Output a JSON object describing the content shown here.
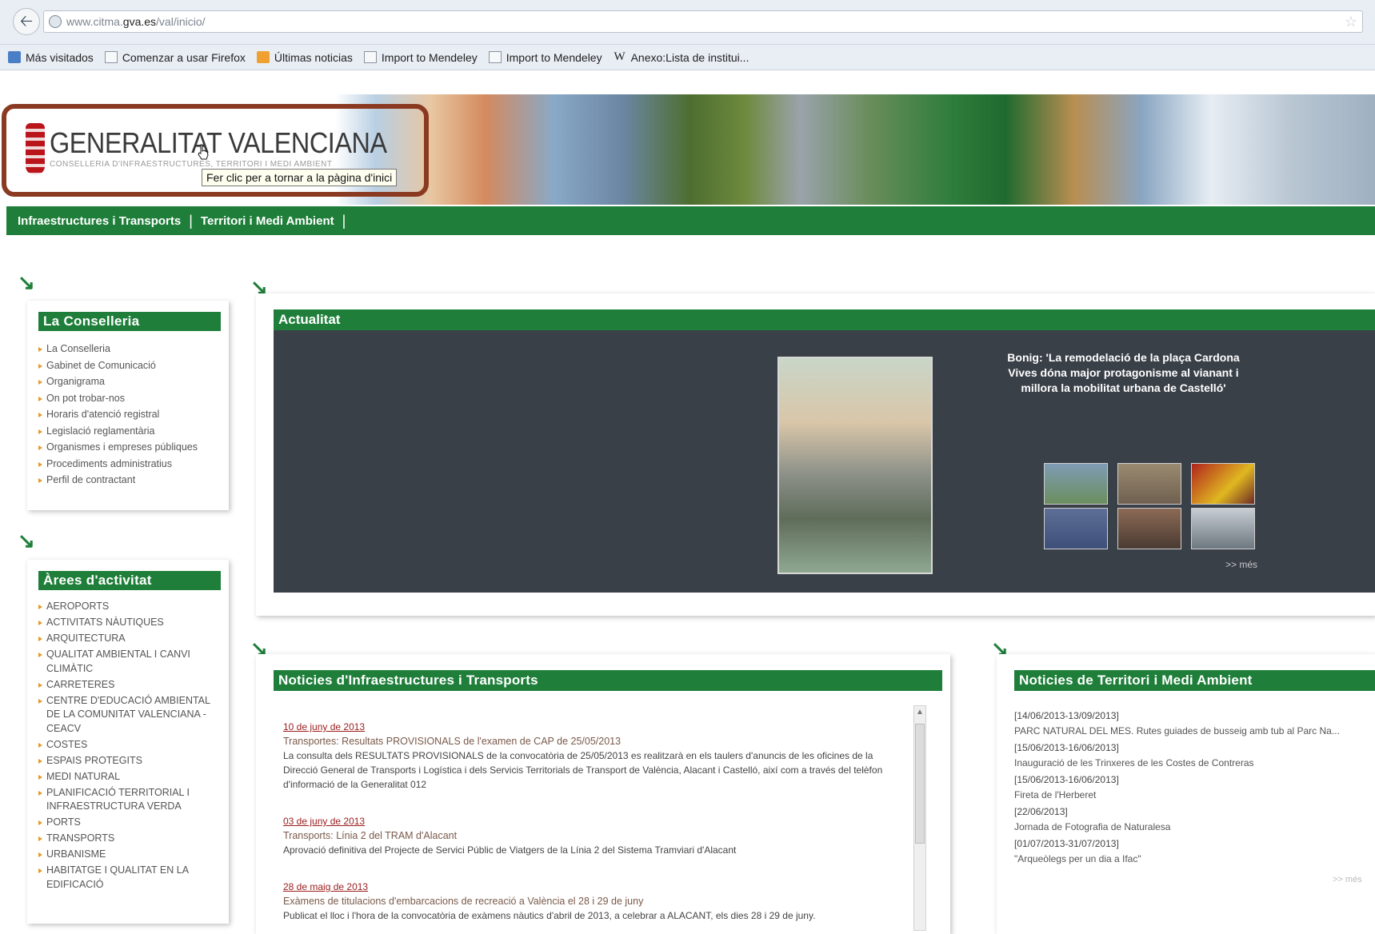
{
  "browser": {
    "url_prefix": "www.citma.",
    "url_domain": "gva.es",
    "url_path": "/val/inicio/",
    "bookmarks": [
      "Más visitados",
      "Comenzar a usar Firefox",
      "Últimas noticias",
      "Import to Mendeley",
      "Import to Mendeley",
      "Anexo:Lista de institui..."
    ]
  },
  "header": {
    "logo_title": "GENERALITAT VALENCIANA",
    "logo_subtitle": "CONSELLERIA D'INFRAESTRUCTURES, TERRITORI I MEDI AMBIENT",
    "tooltip": "Fer clic per a tornar a la pàgina d'inici",
    "highlight_color": "#8b3a22"
  },
  "topnav": {
    "items": [
      "Infraestructures i Transports",
      "Territori i Medi Ambient"
    ]
  },
  "conselleria": {
    "title": "La Conselleria",
    "items": [
      "La Conselleria",
      "Gabinet de Comunicació",
      "Organigrama",
      "On pot trobar-nos",
      "Horaris d'atenció registral",
      "Legislació reglamentària",
      "Organismes i empreses públiques",
      "Procediments administratius",
      "Perfil de contractant"
    ]
  },
  "arees": {
    "title": "Àrees d'activitat",
    "items": [
      "AEROPORTS",
      "ACTIVITATS NÀUTIQUES",
      "ARQUITECTURA",
      "QUALITAT AMBIENTAL I CANVI CLIMÀTIC",
      "CARRETERES",
      "CENTRE D'EDUCACIÓ AMBIENTAL DE LA COMUNITAT VALENCIANA - CEACV",
      "COSTES",
      "ESPAIS PROTEGITS",
      "MEDI NATURAL",
      "PLANIFICACIÓ TERRITORIAL I INFRAESTRUCTURA VERDA",
      "PORTS",
      "TRANSPORTS",
      "URBANISME",
      "HABITATGE I QUALITAT EN LA EDIFICACIÓ"
    ]
  },
  "actualitat": {
    "title": "Actualitat",
    "caption": "Bonig: 'La remodelació de la plaça Cardona Vives dóna major protagonisme al vianant i millora la mobilitat urbana de Castelló'",
    "more": ">> més",
    "accent": "#1f7f3a",
    "panel_color": "#3a4048"
  },
  "infra_news": {
    "title": "Noticies d'Infraestructures i Transports",
    "items": [
      {
        "date": "10 de juny de 2013",
        "title": "Transportes: Resultats PROVISIONALS de l'examen de CAP de 25/05/2013",
        "body": "La consulta dels RESULTATS PROVISIONALS de la convocatòria de 25/05/2013 es realitzarà en els taulers d'anuncis de les oficines de la Direcció General de Transports i Logística i dels Servicis Territorials de Transport de València, Alacant i Castelló, així com a través del telèfon d'informació de la Generalitat 012"
      },
      {
        "date": "03 de juny de 2013",
        "title": "Transports: Línia 2 del TRAM d'Alacant",
        "body": "Aprovació definitiva del Projecte de Servici Públic de Viatgers de la Línia 2 del Sistema Tramviari d'Alacant"
      },
      {
        "date": "28 de maig de 2013",
        "title": "Exàmens de titulacions d'embarcacions de recreació a València el 28 i 29 de juny",
        "body": "Publicat el lloc i l'hora de la convocatòria de exàmens nàutics d'abril de 2013, a celebrar a ALACANT, els dies 28 i 29 de juny."
      }
    ]
  },
  "territori_news": {
    "title": "Noticies de Territori i Medi Ambient",
    "items": [
      {
        "date": "[14/06/2013-13/09/2013]",
        "text": "PARC NATURAL DEL MES. Rutes guiades de busseig amb tub al Parc Na..."
      },
      {
        "date": "[15/06/2013-16/06/2013]",
        "text": "Inauguració de les Trinxeres de les Costes de Contreras"
      },
      {
        "date": "[15/06/2013-16/06/2013]",
        "text": "Fireta de l'Herberet"
      },
      {
        "date": "[22/06/2013]",
        "text": "Jornada de Fotografia de Naturalesa"
      },
      {
        "date": "[01/07/2013-31/07/2013]",
        "text": "\"Arqueòlegs per un dia a Ifac\""
      }
    ],
    "more": ">> més"
  }
}
